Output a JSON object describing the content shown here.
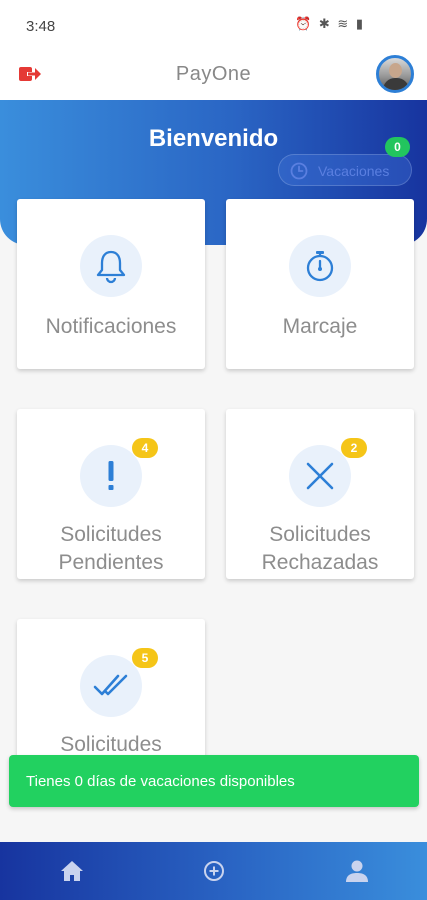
{
  "status_bar": {
    "time": "3:48",
    "icons": "⏰ ✱ ≋ ▮"
  },
  "app_bar": {
    "title": "PayOne"
  },
  "header": {
    "welcome": "Bienvenido",
    "vacation_chip_label": "Vacaciones",
    "vacation_badge": "0"
  },
  "cards": {
    "notifications": {
      "label": "Notificaciones",
      "icon": "bell-icon"
    },
    "check_in": {
      "label": "Marcaje",
      "icon": "stopwatch-icon"
    },
    "pending": {
      "line1": "Solicitudes",
      "line2": "Pendientes",
      "badge": "4",
      "icon": "exclamation-icon"
    },
    "rejected": {
      "line1": "Solicitudes",
      "line2": "Rechazadas",
      "badge": "2",
      "icon": "x-icon"
    },
    "approved": {
      "line1": "Solicitudes",
      "badge": "5",
      "icon": "double-check-icon"
    }
  },
  "toast": {
    "message": "Tienes 0 días de vacaciones disponibles"
  },
  "bottom_nav": {
    "items": [
      "home-icon",
      "add-circle-icon",
      "person-icon"
    ]
  },
  "colors": {
    "accent_blue": "#2a65c4",
    "dark_blue": "#17349f",
    "success_green": "#22d160",
    "badge_yellow": "#f5c518",
    "logout_red": "#e53935"
  }
}
